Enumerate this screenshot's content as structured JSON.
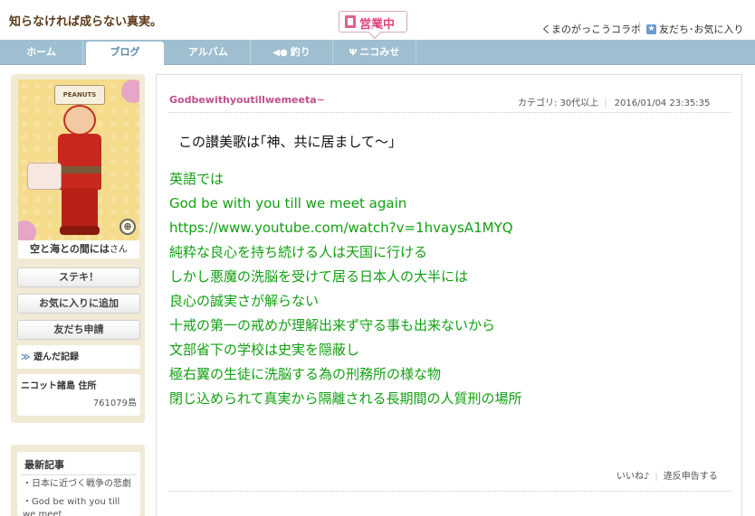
{
  "header": {
    "site_title": "知らなければ成らない真実。",
    "status_badge": "営業中",
    "collab_link": "くまのがっこうコラボ",
    "friends_link": "友だち･お気に入り",
    "star_icon": "★"
  },
  "nav": {
    "items": [
      {
        "label": "ホーム",
        "icon": ""
      },
      {
        "label": "ブログ",
        "icon": ""
      },
      {
        "label": "アルバム",
        "icon": ""
      },
      {
        "label": "釣り",
        "icon": "fishing-icon"
      },
      {
        "label": "ニコみせ",
        "icon": "shop-icon"
      }
    ],
    "active_index": 1
  },
  "sidebar": {
    "avatar_hat_text": "PEANUTS",
    "zoom_icon": "⊕",
    "user_name": "空と海との間には",
    "user_suffix": "さん",
    "buttons": [
      "ステキ！",
      "お気に入りに追加",
      "友だち申請"
    ],
    "played_record": {
      "arrow": "≫",
      "label": "遊んだ記録"
    },
    "address": {
      "title": "ニコット諸島 住所",
      "value": "761079島"
    },
    "recent": {
      "title": "最新記事",
      "items": [
        "・日本に近づく戦争の悲劇",
        "・God be with you till we meet"
      ]
    }
  },
  "post": {
    "title": "Godbewithyoutillwemeeta~",
    "category": "カテゴリ: 30代以上",
    "date": "2016/01/04 23:35:35",
    "lead": "この讃美歌は｢神、共に居まして～｣",
    "lines": [
      "英語では",
      "God be  with you till we meet again",
      "https://www.youtube.com/watch?v=1hvaysA1MYQ",
      "純粋な良心を持ち続ける人は天国に行ける",
      "しかし悪魔の洗脳を受けて居る日本人の大半には",
      "良心の誠実さが解らない",
      "十戒の第一の戒めが理解出来ず守る事も出来ないから",
      "文部省下の学校は史実を隠蔽し",
      "極右翼の生徒に洗脳する為の刑務所の様な物",
      "閉じ込められて真実から隔離される長期間の人質刑の場所"
    ],
    "like_label": "いいね♪",
    "report_label": "違反申告する"
  }
}
